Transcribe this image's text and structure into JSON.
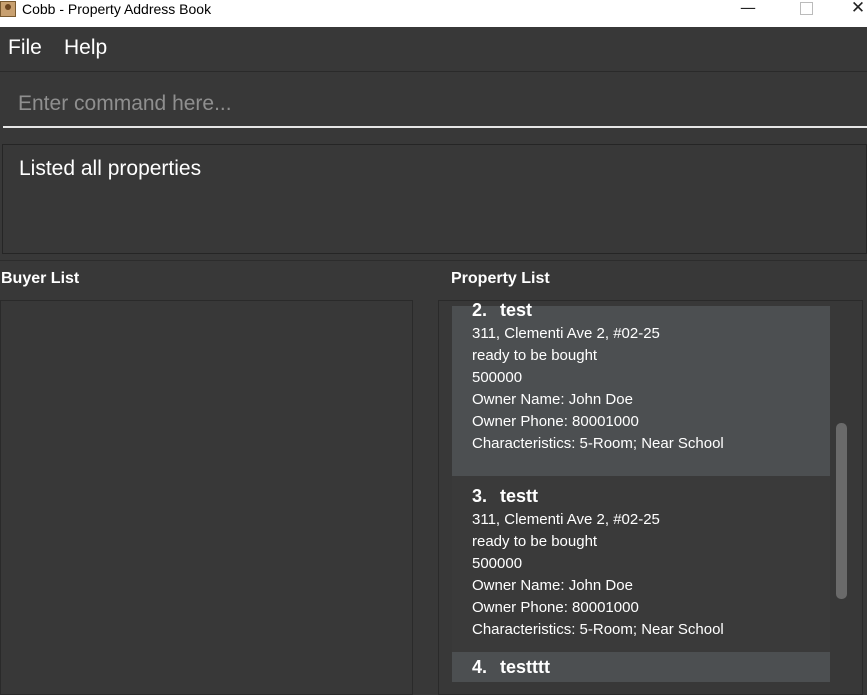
{
  "window": {
    "title": "Cobb - Property Address Book",
    "minimize": "—",
    "close": "✕"
  },
  "menu": {
    "file": "File",
    "help": "Help"
  },
  "command": {
    "placeholder": "Enter command here...",
    "value": ""
  },
  "result": {
    "text": "Listed all properties"
  },
  "buyer_panel": {
    "title": "Buyer List"
  },
  "property_panel": {
    "title": "Property List",
    "cards": [
      {
        "index": "2.",
        "name": "test",
        "address": "311, Clementi Ave 2, #02-25",
        "status": "ready to be bought",
        "price": "500000",
        "owner_name": "Owner Name: John Doe",
        "owner_phone": "Owner Phone: 80001000",
        "characteristics": "Characteristics: 5-Room; Near School"
      },
      {
        "index": "3.",
        "name": "testt",
        "address": "311, Clementi Ave 2, #02-25",
        "status": "ready to be bought",
        "price": "500000",
        "owner_name": "Owner Name: John Doe",
        "owner_phone": "Owner Phone: 80001000",
        "characteristics": "Characteristics: 5-Room; Near School"
      },
      {
        "index": "4.",
        "name": "testttt"
      }
    ]
  },
  "colors": {
    "background": "#383838",
    "card_highlight": "#4c4f51",
    "text": "#ffffff"
  }
}
